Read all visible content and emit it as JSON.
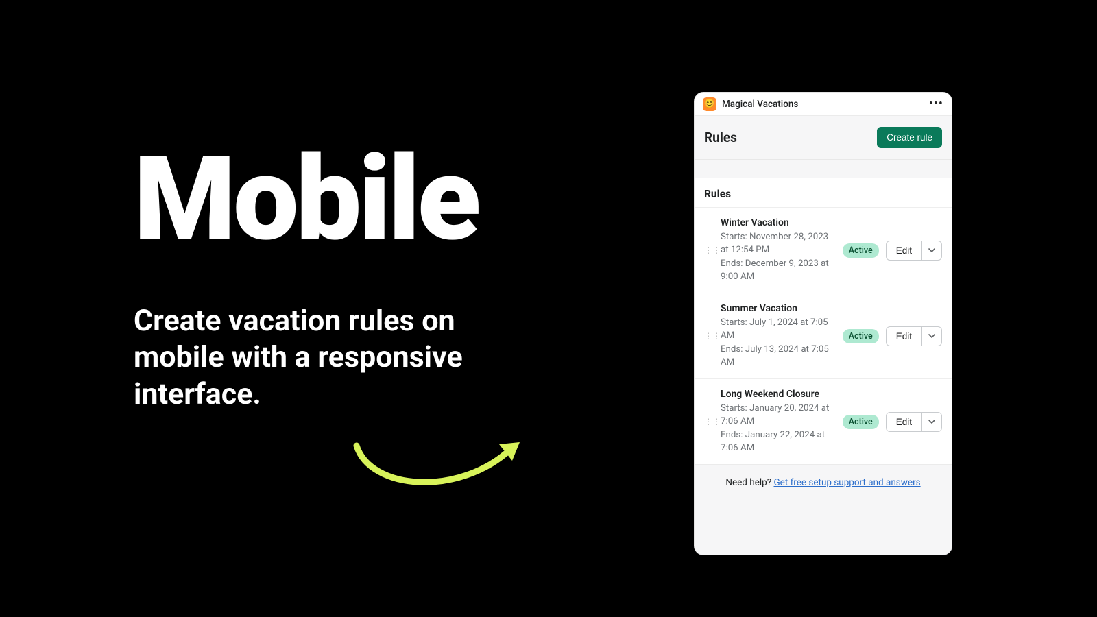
{
  "hero": {
    "title": "Mobile",
    "subtitle": "Create vacation rules on mobile with a responsive interface."
  },
  "app": {
    "title": "Magical Vacations",
    "icon_glyph": "😊"
  },
  "page": {
    "title": "Rules",
    "create_label": "Create rule"
  },
  "card": {
    "title": "Rules"
  },
  "rules": [
    {
      "name": "Winter Vacation",
      "starts": "Starts: November 28, 2023 at 12:54 PM",
      "ends": "Ends: December 9, 2023 at 9:00 AM",
      "status": "Active",
      "edit_label": "Edit"
    },
    {
      "name": "Summer Vacation",
      "starts": "Starts: July 1, 2024 at 7:05 AM",
      "ends": "Ends: July 13, 2024 at 7:05 AM",
      "status": "Active",
      "edit_label": "Edit"
    },
    {
      "name": "Long Weekend Closure",
      "starts": "Starts: January 20, 2024 at 7:06 AM",
      "ends": "Ends: January 22, 2024 at 7:06 AM",
      "status": "Active",
      "edit_label": "Edit"
    }
  ],
  "help": {
    "prefix": "Need help? ",
    "link_text": "Get free setup support and answers"
  },
  "colors": {
    "accent": "#0a7a5a",
    "badge_bg": "#aee9d1",
    "link": "#2c6ecb",
    "arrow": "#d8f35a"
  }
}
